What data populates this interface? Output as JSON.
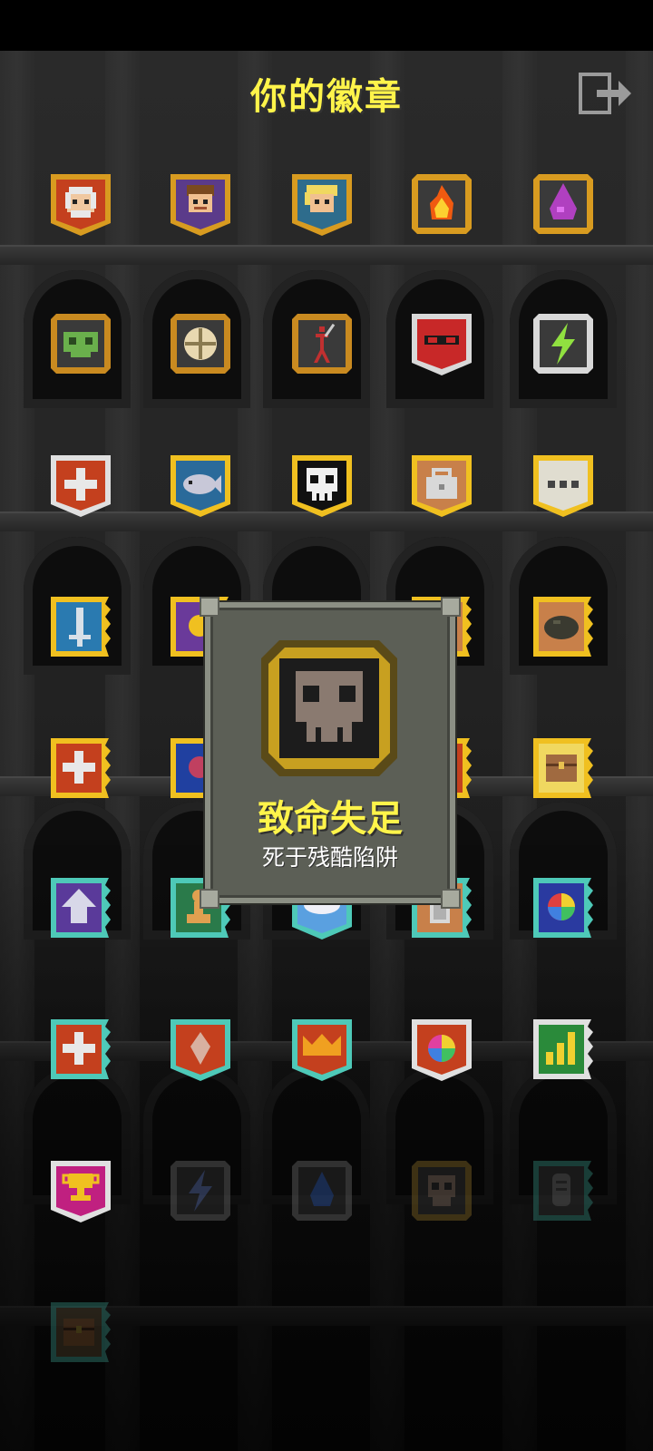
{
  "header": {
    "title": "你的徽章"
  },
  "popup": {
    "name": "致命失足",
    "description": "死于残酷陷阱"
  },
  "colors": {
    "gold": "#d89b20",
    "teal": "#4ec9b8",
    "title_yellow": "#fff44a"
  },
  "badges": [
    {
      "id": "b1",
      "icon": "white-haired-hero-icon"
    },
    {
      "id": "b2",
      "icon": "brown-haired-hero-icon"
    },
    {
      "id": "b3",
      "icon": "blonde-hero-icon"
    },
    {
      "id": "b4",
      "icon": "fire-icon"
    },
    {
      "id": "b5",
      "icon": "purple-potion-drop-icon"
    },
    {
      "id": "b6",
      "icon": "green-skull-icon"
    },
    {
      "id": "b7",
      "icon": "rune-circle-icon"
    },
    {
      "id": "b8",
      "icon": "red-stick-figure-icon"
    },
    {
      "id": "b9",
      "icon": "red-goggles-icon"
    },
    {
      "id": "b10",
      "icon": "lightning-icon"
    },
    {
      "id": "b11",
      "icon": "plus-icon"
    },
    {
      "id": "b12",
      "icon": "fish-icon"
    },
    {
      "id": "b13",
      "icon": "skull-icon"
    },
    {
      "id": "b14",
      "icon": "bag-icon"
    },
    {
      "id": "b15",
      "icon": "ellipsis-icon"
    },
    {
      "id": "b16",
      "icon": "sword-icon"
    },
    {
      "id": "b17",
      "icon": "rock-icon"
    },
    {
      "id": "b18",
      "icon": "plus-icon"
    },
    {
      "id": "b19",
      "icon": "chest-icon"
    },
    {
      "id": "b20",
      "icon": "up-arrow-icon"
    },
    {
      "id": "b21",
      "icon": "pawn-icon"
    },
    {
      "id": "b22",
      "icon": "cloud-icon"
    },
    {
      "id": "b23",
      "icon": "door-icon"
    },
    {
      "id": "b24",
      "icon": "color-wheel-icon"
    },
    {
      "id": "b25",
      "icon": "plus-icon"
    },
    {
      "id": "b26",
      "icon": "gem-icon"
    },
    {
      "id": "b27",
      "icon": "crown-icon"
    },
    {
      "id": "b28",
      "icon": "color-wheel-icon"
    },
    {
      "id": "b29",
      "icon": "bar-chart-icon"
    },
    {
      "id": "b30",
      "icon": "trophy-icon"
    },
    {
      "id": "b31",
      "icon": "lightning-icon"
    },
    {
      "id": "b32",
      "icon": "water-drop-icon"
    },
    {
      "id": "b33",
      "icon": "skull-icon"
    },
    {
      "id": "b34",
      "icon": "tombstone-icon"
    },
    {
      "id": "b35",
      "icon": "chest-icon"
    }
  ]
}
